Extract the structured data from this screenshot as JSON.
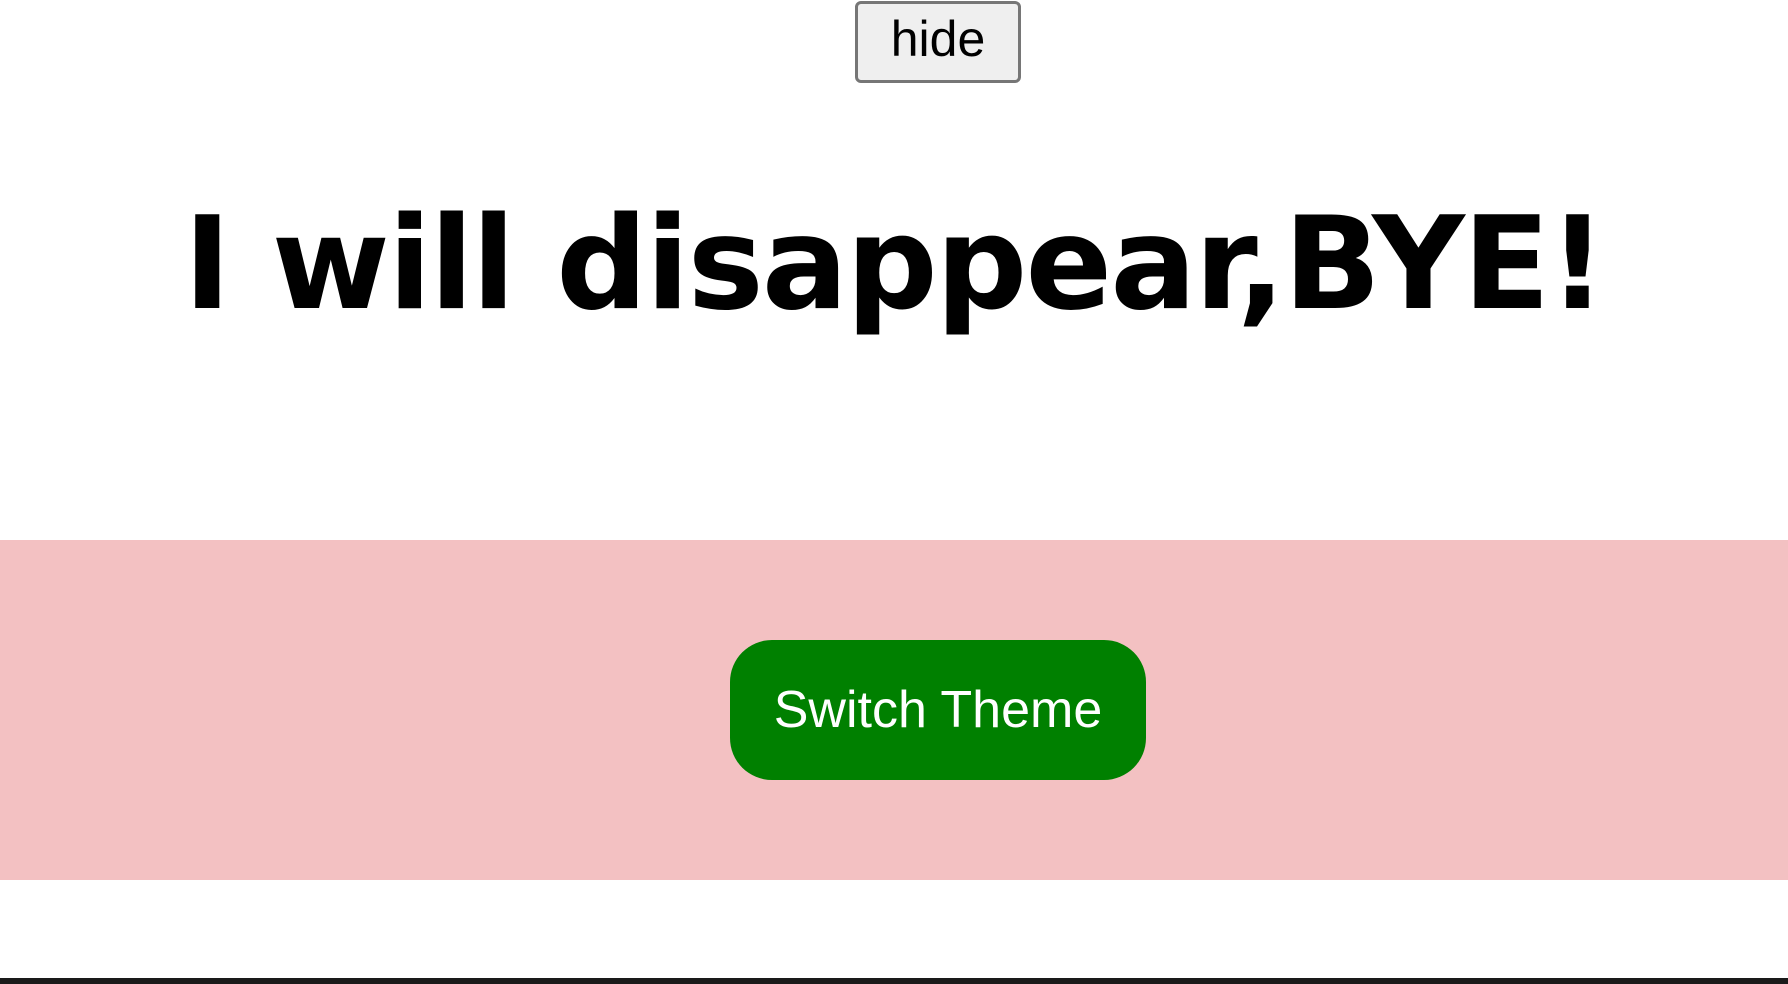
{
  "controls": {
    "hide_label": "hide"
  },
  "content": {
    "heading": "I will disappear,BYE!"
  },
  "theme_section": {
    "background_color": "#f3c1c2",
    "switch_label": "Switch Theme",
    "button_color": "#008000"
  }
}
